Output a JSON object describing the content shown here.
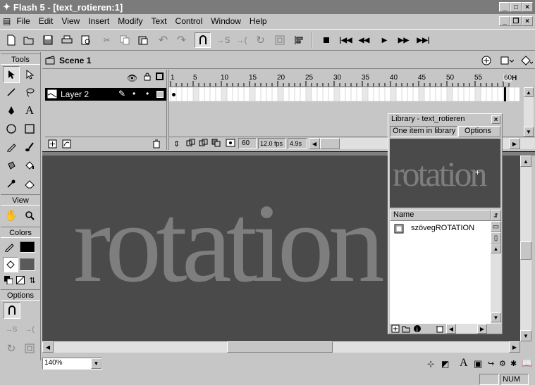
{
  "window": {
    "title": "Flash 5 - [text_rotieren:1]"
  },
  "menu": [
    "File",
    "Edit",
    "View",
    "Insert",
    "Modify",
    "Text",
    "Control",
    "Window",
    "Help"
  ],
  "tools": {
    "header": "Tools",
    "view_header": "View",
    "colors_header": "Colors",
    "options_header": "Options"
  },
  "scene": {
    "label": "Scene 1"
  },
  "timeline": {
    "layer_name": "Layer 2",
    "frame_numbers": [
      "1",
      "5",
      "10",
      "15",
      "20",
      "25",
      "30",
      "35",
      "40",
      "45",
      "50",
      "55",
      "60"
    ],
    "current_frame": "60",
    "frame_rate": "12.0 fps",
    "elapsed_time": "4.9s",
    "playhead_frame": "60",
    "end_marker": "H"
  },
  "stage": {
    "text": "rotation"
  },
  "library": {
    "title": "Library - text_rotieren",
    "count_text": "One item in library",
    "options_label": "Options",
    "preview_text": "rotation",
    "column_name": "Name",
    "items": [
      {
        "name": "szövegROTATION",
        "icon": "symbol-icon"
      }
    ]
  },
  "status": {
    "zoom": "140%",
    "num": "NUM"
  },
  "colors": {
    "stage_bg": "#4a4a4a",
    "stage_text": "#7e7e7e",
    "layer_selected": "#000000",
    "title_bg": "#7b7b7b"
  }
}
